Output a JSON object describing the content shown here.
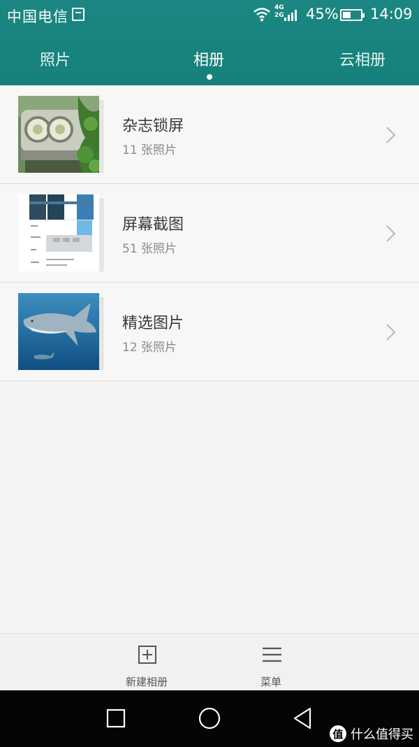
{
  "status_bar": {
    "carrier": "中国电信",
    "network_top": "4G",
    "network_bottom": "2G",
    "battery_percent_text": "45%",
    "battery_level": 0.45,
    "time": "14:09"
  },
  "tabs": [
    {
      "label": "照片",
      "active": false
    },
    {
      "label": "相册",
      "active": true
    },
    {
      "label": "云相册",
      "active": false
    }
  ],
  "albums": [
    {
      "name": "杂志锁屏",
      "count": "11 张照片",
      "thumb": "car-headlights-image"
    },
    {
      "name": "屏幕截图",
      "count": "51 张照片",
      "thumb": "screenshot-image"
    },
    {
      "name": "精选图片",
      "count": "12 张照片",
      "thumb": "shark-image"
    }
  ],
  "bottom_bar": {
    "new_album_label": "新建相册",
    "menu_label": "菜单"
  },
  "watermark": {
    "icon_char": "值",
    "text": "什么值得买"
  },
  "colors": {
    "header": "#16807b",
    "background": "#f4f4f4",
    "nav_bar": "#050505"
  }
}
